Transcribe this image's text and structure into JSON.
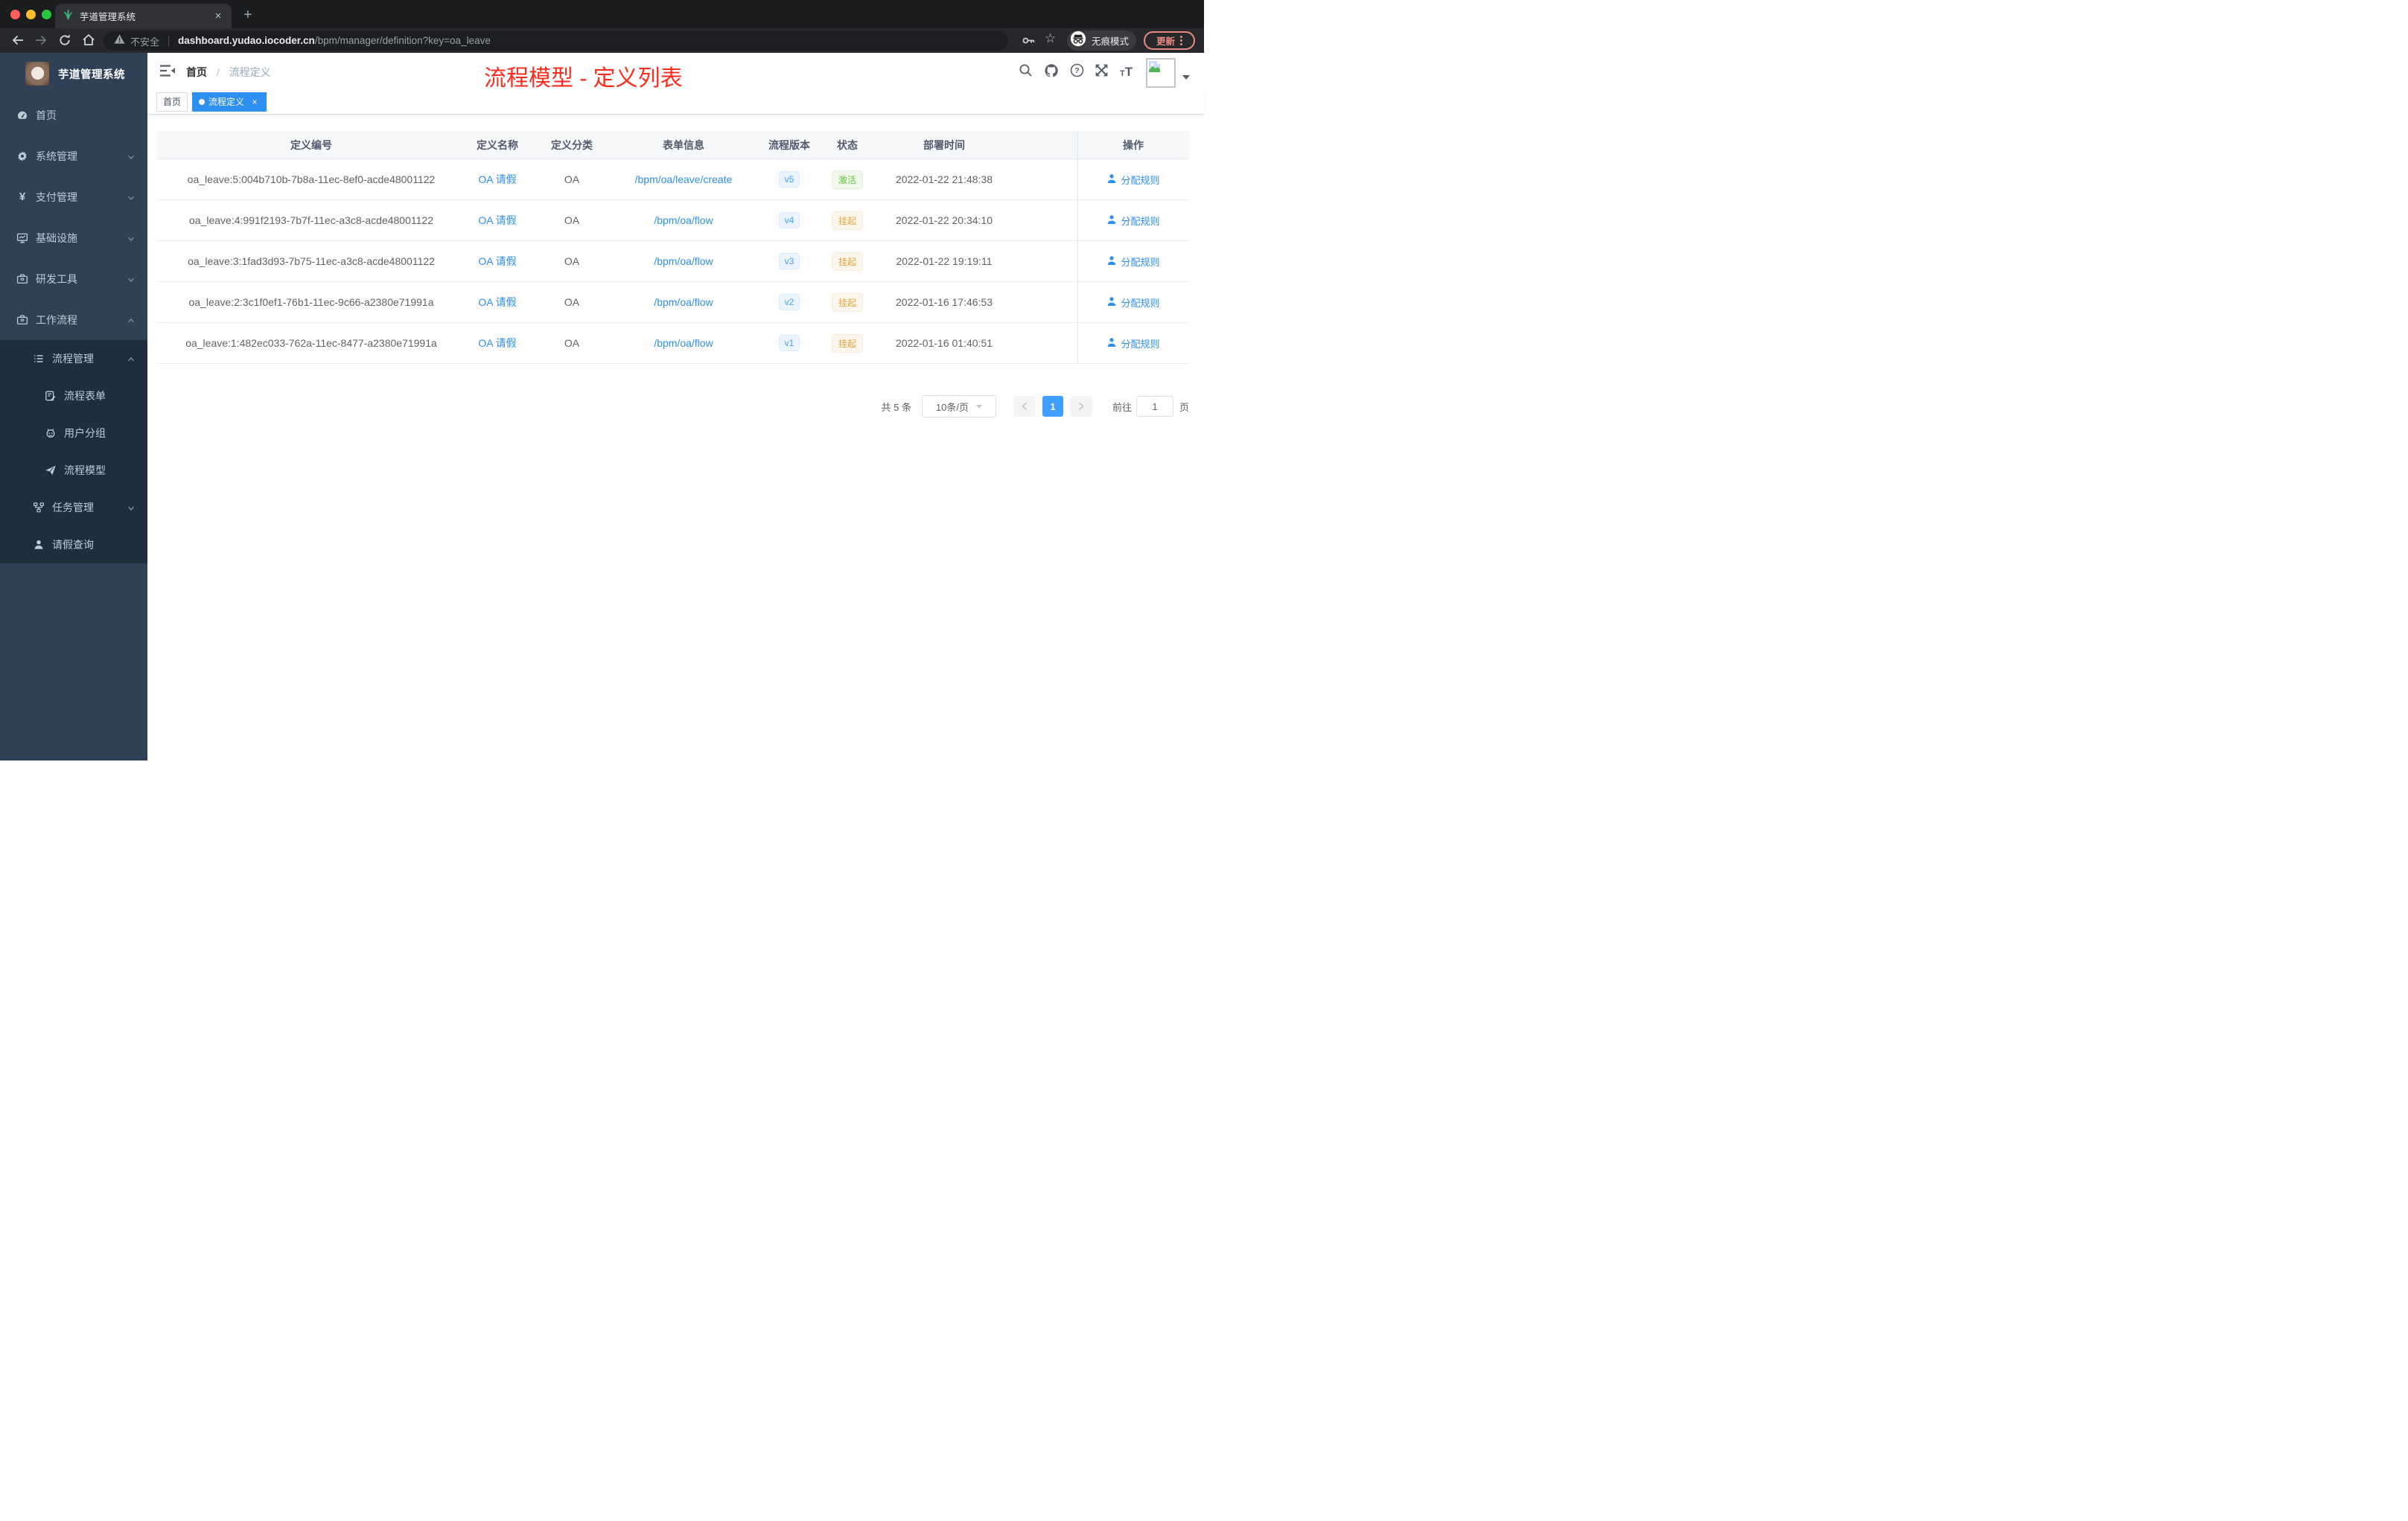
{
  "colors": {
    "accent_blue": "#409eff",
    "link_blue": "#2d8ff0",
    "annotation_red": "#fb2c1d",
    "sidebar_bg": "#304156",
    "submenu_bg": "#1f2d3d",
    "status_active_green": "#67c23a",
    "status_suspend_orange": "#e6a23c",
    "update_salmon": "#ee8d82"
  },
  "browser": {
    "tab_title": "芋道管理系统",
    "new_tab_glyph": "+",
    "close_glyph": "×",
    "security_label": "不安全",
    "url_host": "dashboard.yudao.iocoder.cn",
    "url_path": "/bpm/manager/definition?key=oa_leave",
    "incognito_label": "无痕模式",
    "update_label": "更新",
    "star_glyph": "☆"
  },
  "sidebar": {
    "title": "芋道管理系统",
    "items": [
      {
        "icon": "dashboard-icon",
        "label": "首页",
        "level": 1,
        "chevron": null,
        "submenu": false
      },
      {
        "icon": "gear-icon",
        "label": "系统管理",
        "level": 1,
        "chevron": "down",
        "submenu": false
      },
      {
        "icon": "yuan-icon",
        "label": "支付管理",
        "level": 1,
        "chevron": "down",
        "submenu": false
      },
      {
        "icon": "monitor-icon",
        "label": "基础设施",
        "level": 1,
        "chevron": "down",
        "submenu": false
      },
      {
        "icon": "toolbox-icon",
        "label": "研发工具",
        "level": 1,
        "chevron": "down",
        "submenu": false
      },
      {
        "icon": "briefcase-icon",
        "label": "工作流程",
        "level": 1,
        "chevron": "up",
        "submenu": false
      },
      {
        "icon": "list-icon",
        "label": "流程管理",
        "level": 2,
        "chevron": "up",
        "submenu": true
      },
      {
        "icon": "form-icon",
        "label": "流程表单",
        "level": 3,
        "chevron": null,
        "submenu": true
      },
      {
        "icon": "robot-icon",
        "label": "用户分组",
        "level": 3,
        "chevron": null,
        "submenu": true
      },
      {
        "icon": "plane-icon",
        "label": "流程模型",
        "level": 3,
        "chevron": null,
        "submenu": true
      },
      {
        "icon": "tree-icon",
        "label": "任务管理",
        "level": 2,
        "chevron": "down",
        "submenu": true
      },
      {
        "icon": "user-icon",
        "label": "请假查询",
        "level": 2,
        "chevron": null,
        "submenu": true
      }
    ]
  },
  "header": {
    "breadcrumb": {
      "home": "首页",
      "separator": "/",
      "current": "流程定义"
    },
    "annotation": "流程模型 - 定义列表"
  },
  "tags": {
    "home_label": "首页",
    "active_label": "流程定义",
    "active_close_glyph": "×"
  },
  "table": {
    "headers": [
      "定义编号",
      "定义名称",
      "定义分类",
      "表单信息",
      "流程版本",
      "状态",
      "部署时间",
      "操作"
    ],
    "action_label": "分配规则",
    "rows": [
      {
        "id": "oa_leave:5:004b710b-7b8a-11ec-8ef0-acde48001122",
        "name": "OA 请假",
        "category": "OA",
        "form": "/bpm/oa/leave/create",
        "version": "v5",
        "status": "激活",
        "status_type": "success",
        "deploy_time": "2022-01-22 21:48:38"
      },
      {
        "id": "oa_leave:4:991f2193-7b7f-11ec-a3c8-acde48001122",
        "name": "OA 请假",
        "category": "OA",
        "form": "/bpm/oa/flow",
        "version": "v4",
        "status": "挂起",
        "status_type": "warning",
        "deploy_time": "2022-01-22 20:34:10"
      },
      {
        "id": "oa_leave:3:1fad3d93-7b75-11ec-a3c8-acde48001122",
        "name": "OA 请假",
        "category": "OA",
        "form": "/bpm/oa/flow",
        "version": "v3",
        "status": "挂起",
        "status_type": "warning",
        "deploy_time": "2022-01-22 19:19:11"
      },
      {
        "id": "oa_leave:2:3c1f0ef1-76b1-11ec-9c66-a2380e71991a",
        "name": "OA 请假",
        "category": "OA",
        "form": "/bpm/oa/flow",
        "version": "v2",
        "status": "挂起",
        "status_type": "warning",
        "deploy_time": "2022-01-16 17:46:53"
      },
      {
        "id": "oa_leave:1:482ec033-762a-11ec-8477-a2380e71991a",
        "name": "OA 请假",
        "category": "OA",
        "form": "/bpm/oa/flow",
        "version": "v1",
        "status": "挂起",
        "status_type": "warning",
        "deploy_time": "2022-01-16 01:40:51"
      }
    ]
  },
  "pagination": {
    "total_label": "共 5 条",
    "page_size": "10条/页",
    "current_page": "1",
    "goto_label": "前往",
    "goto_value": "1",
    "page_unit": "页"
  }
}
